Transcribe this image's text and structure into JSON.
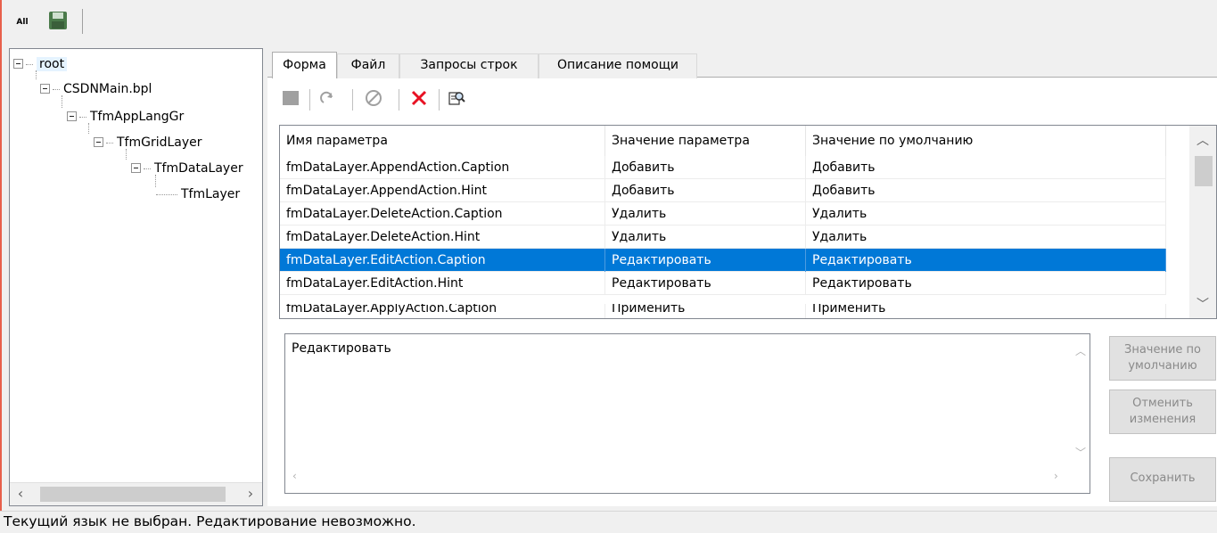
{
  "toolbar": {
    "all_label": "All",
    "save_icon": "floppy-disk-icon"
  },
  "tree": {
    "nodes": [
      {
        "label": "root"
      },
      {
        "label": "CSDNMain.bpl"
      },
      {
        "label": "TfmAppLangGr"
      },
      {
        "label": "TfmGridLayer"
      },
      {
        "label": "TfmDataLayer"
      },
      {
        "label": "TfmLayer"
      }
    ]
  },
  "tabs": [
    {
      "label": "Форма"
    },
    {
      "label": "Файл"
    },
    {
      "label": "Запросы строк"
    },
    {
      "label": "Описание помощи"
    }
  ],
  "inner_toolbar": {
    "icons": [
      "stop-icon",
      "redo-icon",
      "cancel-icon",
      "delete-icon",
      "find-icon"
    ],
    "colors": {
      "delete": "#e81123",
      "disabled": "#a0a0a0"
    }
  },
  "grid": {
    "columns": [
      "Имя параметра",
      "Значение параметра",
      "Значение по умолчанию"
    ],
    "rows": [
      [
        "fmDataLayer.AppendAction.Caption",
        "Добавить",
        "Добавить"
      ],
      [
        "fmDataLayer.AppendAction.Hint",
        "Добавить",
        "Добавить"
      ],
      [
        "fmDataLayer.DeleteAction.Caption",
        "Удалить",
        "Удалить"
      ],
      [
        "fmDataLayer.DeleteAction.Hint",
        "Удалить",
        "Удалить"
      ],
      [
        "fmDataLayer.EditAction.Caption",
        "Редактировать",
        "Редактировать"
      ],
      [
        "fmDataLayer.EditAction.Hint",
        "Редактировать",
        "Редактировать"
      ],
      [
        "fmDataLayer.ApplyAction.Caption",
        "Применить",
        "Применить"
      ]
    ],
    "selected_row": 4,
    "selection_color": "#0078d7"
  },
  "editor": {
    "value": "Редактировать"
  },
  "buttons": {
    "default_value": "Значение по умолчанию",
    "cancel_changes": "Отменить изменения",
    "save": "Сохранить"
  },
  "status": {
    "text": "Текущий язык не выбран. Редактирование невозможно."
  }
}
